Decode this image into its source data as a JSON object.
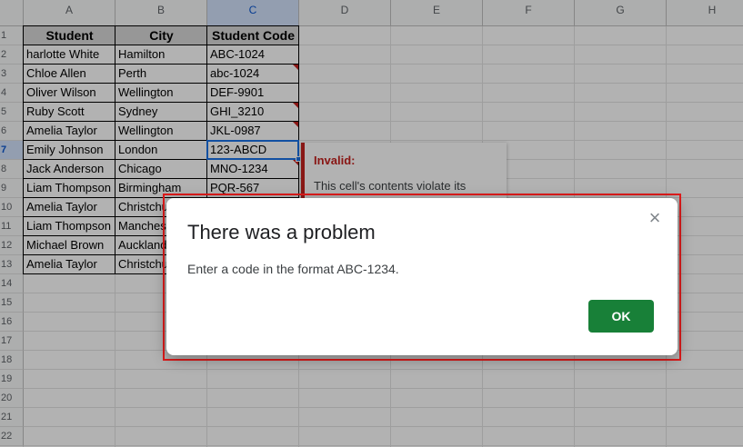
{
  "sheet": {
    "columns": [
      "A",
      "B",
      "C",
      "D",
      "E",
      "F",
      "G",
      "H"
    ],
    "rows": [
      "1",
      "2",
      "3",
      "4",
      "5",
      "6",
      "7",
      "8",
      "9",
      "10",
      "11",
      "12",
      "13",
      "14",
      "15",
      "16",
      "17",
      "18",
      "19",
      "20",
      "21",
      "22"
    ],
    "selected_column": "C",
    "selected_row": "7",
    "table": {
      "header": [
        "Student",
        "City",
        "Student Code"
      ],
      "rows": [
        [
          "harlotte White",
          "Hamilton",
          "ABC-1024"
        ],
        [
          "Chloe Allen",
          "Perth",
          "abc-1024"
        ],
        [
          "Oliver Wilson",
          "Wellington",
          "DEF-9901"
        ],
        [
          "Ruby Scott",
          "Sydney",
          "GHI_3210"
        ],
        [
          "Amelia Taylor",
          "Wellington",
          "JKL-0987"
        ],
        [
          "Emily Johnson",
          "London",
          "123-ABCD"
        ],
        [
          "Jack Anderson",
          "Chicago",
          "MNO-1234"
        ],
        [
          "Liam Thompson",
          "Birmingham",
          "PQR-567"
        ],
        [
          "Amelia Taylor",
          "Christchurch",
          ""
        ],
        [
          "Liam Thompson",
          "Manchester",
          ""
        ],
        [
          "Michael Brown",
          "Auckland",
          ""
        ],
        [
          "Amelia Taylor",
          "Christchurch",
          ""
        ]
      ],
      "invalid_flag_rows": [
        2,
        4,
        5,
        7,
        9
      ]
    }
  },
  "validation_hint": {
    "title": "Invalid:",
    "body": "This cell's contents violate its"
  },
  "dialog": {
    "title": "There was a problem",
    "message": "Enter a code in the format ABC-1234.",
    "ok_label": "OK",
    "close_glyph": "×"
  },
  "colors": {
    "ok_button": "#188038",
    "highlight_border": "#e01b1b",
    "invalid_flag": "#c5221f",
    "selection": "#1a73e8"
  }
}
